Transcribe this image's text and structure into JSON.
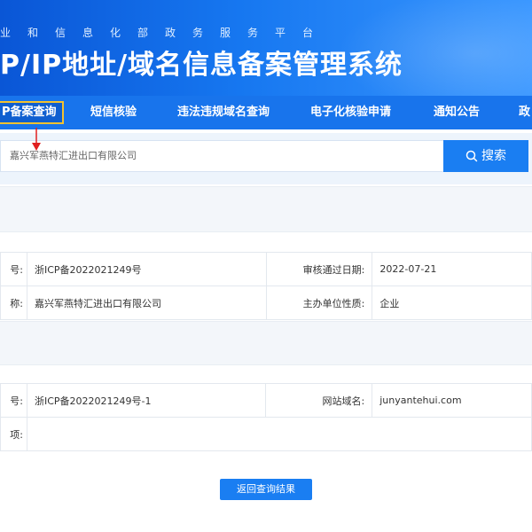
{
  "banner": {
    "subtitle": "业和信息化部政务服务平台",
    "title": "P/IP地址/域名信息备案管理系统"
  },
  "nav": {
    "items": [
      {
        "label": "P备案查询"
      },
      {
        "label": "短信核验"
      },
      {
        "label": "违法违规域名查询"
      },
      {
        "label": "电子化核验申请"
      },
      {
        "label": "通知公告"
      },
      {
        "label": "政"
      }
    ]
  },
  "search": {
    "value": "嘉兴军燕特汇进出口有限公司",
    "button_label": "搜索"
  },
  "unit_info": {
    "rows": [
      {
        "label1": "号:",
        "value1": "浙ICP备2022021249号",
        "label2": "审核通过日期:",
        "value2": "2022-07-21"
      },
      {
        "label1": "称:",
        "value1": "嘉兴军燕特汇进出口有限公司",
        "label2": "主办单位性质:",
        "value2": "企业"
      }
    ]
  },
  "site_info": {
    "rows": [
      {
        "label1": "号:",
        "value1": "浙ICP备2022021249号-1",
        "label2": "网站域名:",
        "value2": "junyantehui.com"
      },
      {
        "label1": "项:",
        "value1": "",
        "label2": "",
        "value2": ""
      }
    ]
  },
  "back_button": "返回查询结果",
  "colors": {
    "accent": "#1a7ef2",
    "nav_bg": "#1874ec",
    "highlight_border": "#f2c230",
    "arrow": "#e02020"
  }
}
